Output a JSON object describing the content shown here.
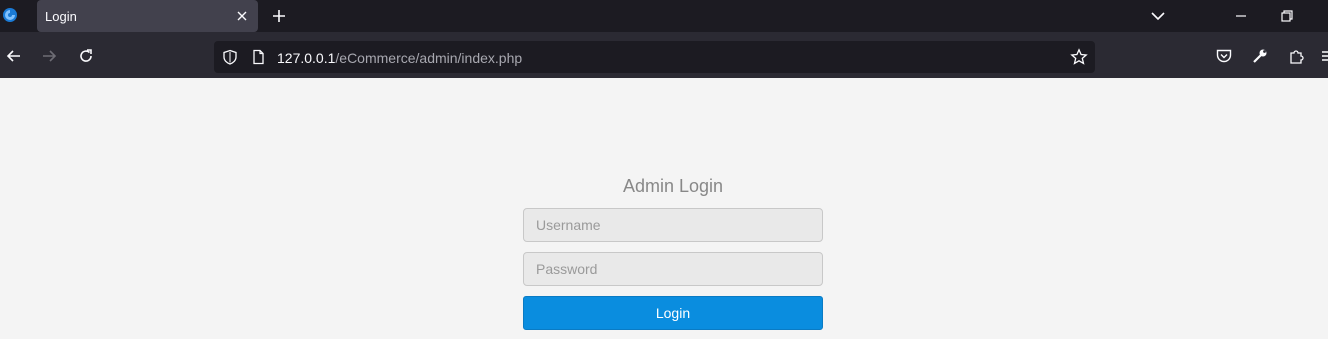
{
  "browser": {
    "tab": {
      "title": "Login"
    },
    "url": {
      "host": "127.0.0.1",
      "path": "/eCommerce/admin/index.php"
    },
    "icons": [
      "browser-logo-icon",
      "close-icon",
      "plus-icon",
      "chevron-down-icon",
      "minimize-icon",
      "restore-icon",
      "back-arrow-icon",
      "forward-arrow-icon",
      "reload-icon",
      "shield-icon",
      "page-icon",
      "star-icon",
      "pocket-icon",
      "wrench-icon",
      "extensions-icon",
      "menu-icon"
    ],
    "colors": {
      "tabbar": "#1c1b22",
      "toolbar": "#2b2a33",
      "active_tab": "#42414d"
    }
  },
  "login": {
    "title": "Admin Login",
    "username_placeholder": "Username",
    "password_placeholder": "Password",
    "button_label": "Login"
  },
  "colors": {
    "page_background": "#f4f4f4",
    "button": "#0a8ddf",
    "title": "#888888"
  }
}
